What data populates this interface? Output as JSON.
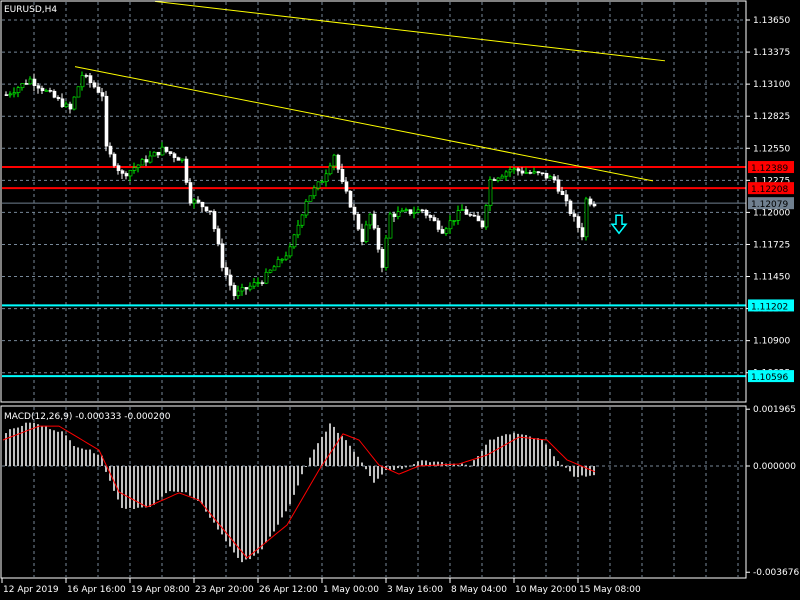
{
  "symbol_label": "EURUSD,H4",
  "macd_label": "MACD(12,26,9) -0.000333 -0.000200",
  "colors": {
    "bg": "#000000",
    "grid": "#778899",
    "bull": "#00ff00",
    "bear": "#ffffff",
    "level_red": "#ff0000",
    "level_cyan": "#00ffff",
    "trend": "#ffff00",
    "hist": "#c0c0c0",
    "signal": "#ff0000"
  },
  "chart_data": [
    {
      "type": "candlestick",
      "title": "EURUSD,H4",
      "ylim": [
        1.1036,
        1.1378
      ],
      "price_ticks": [
        "1.13650",
        "1.13375",
        "1.13100",
        "1.12825",
        "1.12550",
        "1.12275",
        "1.12000",
        "1.11725",
        "1.11450",
        "1.11175",
        "1.10900",
        "1.10625"
      ],
      "time_labels": [
        "12 Apr 2019",
        "16 Apr 16:00",
        "19 Apr 08:00",
        "23 Apr 20:00",
        "26 Apr 12:00",
        "1 May 00:00",
        "3 May 16:00",
        "8 May 04:00",
        "10 May 20:00",
        "15 May 08:00"
      ],
      "bar_count": 148,
      "close_path": [
        [
          0,
          1.1301
        ],
        [
          6,
          1.1314
        ],
        [
          16,
          1.1288
        ],
        [
          19,
          1.1318
        ],
        [
          24,
          1.1301
        ],
        [
          25,
          1.1254
        ],
        [
          29,
          1.1232
        ],
        [
          39,
          1.1254
        ],
        [
          44,
          1.1245
        ],
        [
          46,
          1.1211
        ],
        [
          51,
          1.1202
        ],
        [
          54,
          1.1155
        ],
        [
          57,
          1.1129
        ],
        [
          64,
          1.1142
        ],
        [
          71,
          1.1168
        ],
        [
          75,
          1.1211
        ],
        [
          79,
          1.1228
        ],
        [
          82,
          1.125
        ],
        [
          84,
          1.1224
        ],
        [
          86,
          1.1207
        ],
        [
          89,
          1.1177
        ],
        [
          91,
          1.1198
        ],
        [
          94,
          1.1155
        ],
        [
          96,
          1.1198
        ],
        [
          104,
          1.1202
        ],
        [
          109,
          1.1185
        ],
        [
          114,
          1.1202
        ],
        [
          119,
          1.1189
        ],
        [
          121,
          1.1228
        ],
        [
          126,
          1.1237
        ],
        [
          134,
          1.1232
        ],
        [
          137,
          1.1228
        ],
        [
          140,
          1.1207
        ],
        [
          144,
          1.1181
        ],
        [
          145,
          1.1211
        ],
        [
          147,
          1.1208
        ]
      ],
      "levels": [
        {
          "price": "1.12389",
          "color": "#ff0000"
        },
        {
          "price": "1.12208",
          "color": "#ff0000"
        },
        {
          "price": "1.12079",
          "color": "#708090",
          "current": true
        },
        {
          "price": "1.11202",
          "color": "#00ffff"
        },
        {
          "price": "1.10596",
          "color": "#00ffff"
        }
      ],
      "trendlines": [
        {
          "from": [
            37.5,
            1.1381
          ],
          "to": [
            165,
            1.133
          ]
        },
        {
          "from": [
            17.5,
            1.1325
          ],
          "to": [
            162,
            1.1227
          ]
        }
      ],
      "annotations": [
        {
          "type": "sell-arrow",
          "bar": 153,
          "price": 1.1189
        }
      ]
    },
    {
      "type": "bar+line",
      "title": "MACD(12,26,9)",
      "ylim": [
        -0.003676,
        0.001965
      ],
      "axis_ticks": [
        "0.001965",
        "0.000000",
        "-0.003676"
      ],
      "current_values": {
        "macd": -0.000333,
        "signal": -0.0002
      },
      "hist_path": [
        [
          0,
          0.00118
        ],
        [
          6,
          0.00152
        ],
        [
          14,
          0.00118
        ],
        [
          17,
          0.00073
        ],
        [
          24,
          0.00038
        ],
        [
          25,
          -0.00021
        ],
        [
          29,
          -0.00145
        ],
        [
          36,
          -0.00145
        ],
        [
          41,
          -0.00083
        ],
        [
          45,
          -0.00093
        ],
        [
          49,
          -0.00135
        ],
        [
          54,
          -0.00239
        ],
        [
          59,
          -0.00336
        ],
        [
          64,
          -0.00291
        ],
        [
          71,
          -0.00135
        ],
        [
          74,
          -0.00031
        ],
        [
          77,
          0.00055
        ],
        [
          81,
          0.00145
        ],
        [
          85,
          0.0009
        ],
        [
          89,
          0.00014
        ],
        [
          92,
          -0.00055
        ],
        [
          95,
          -0.00014
        ],
        [
          99,
          -7e-05
        ],
        [
          104,
          0.00021
        ],
        [
          109,
          0.0001
        ],
        [
          116,
          3e-05
        ],
        [
          121,
          0.0009
        ],
        [
          125,
          0.00107
        ],
        [
          127,
          0.00114
        ],
        [
          134,
          0.0009
        ],
        [
          139,
          3e-05
        ],
        [
          142,
          -0.00035
        ],
        [
          147,
          -0.00035
        ]
      ],
      "signal_path": [
        [
          0,
          0.0009
        ],
        [
          9,
          0.00138
        ],
        [
          14,
          0.00138
        ],
        [
          24,
          0.00055
        ],
        [
          29,
          -0.0009
        ],
        [
          36,
          -0.00142
        ],
        [
          44,
          -0.00093
        ],
        [
          49,
          -0.00118
        ],
        [
          61,
          -0.00318
        ],
        [
          71,
          -0.00204
        ],
        [
          79,
          -0.00014
        ],
        [
          85,
          0.00111
        ],
        [
          89,
          0.0009
        ],
        [
          94,
          3e-05
        ],
        [
          99,
          -0.00028
        ],
        [
          104,
          0
        ],
        [
          114,
          7e-05
        ],
        [
          121,
          0.00038
        ],
        [
          129,
          0.001
        ],
        [
          136,
          0.0009
        ],
        [
          141,
          0.00021
        ],
        [
          148,
          -0.0002
        ]
      ]
    }
  ]
}
